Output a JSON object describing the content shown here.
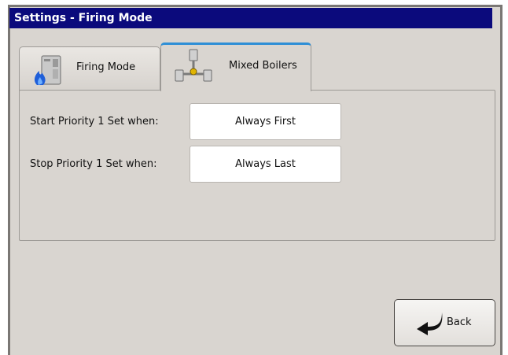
{
  "window": {
    "title": "Settings - Firing Mode"
  },
  "tabs": [
    {
      "label": "Firing Mode",
      "icon": "boiler-flame-icon",
      "active": false
    },
    {
      "label": "Mixed Boilers",
      "icon": "mixed-boilers-icon",
      "active": true
    }
  ],
  "settings": {
    "start": {
      "label": "Start Priority 1 Set when:",
      "value": "Always First"
    },
    "stop": {
      "label": "Stop Priority 1 Set when:",
      "value": "Always Last"
    }
  },
  "footer": {
    "back_label": "Back",
    "back_icon": "back-arrow-icon"
  },
  "colors": {
    "titlebar": "#0b0a7c",
    "active_tab_accent": "#2e8fd6",
    "background": "#d9d5d0"
  }
}
